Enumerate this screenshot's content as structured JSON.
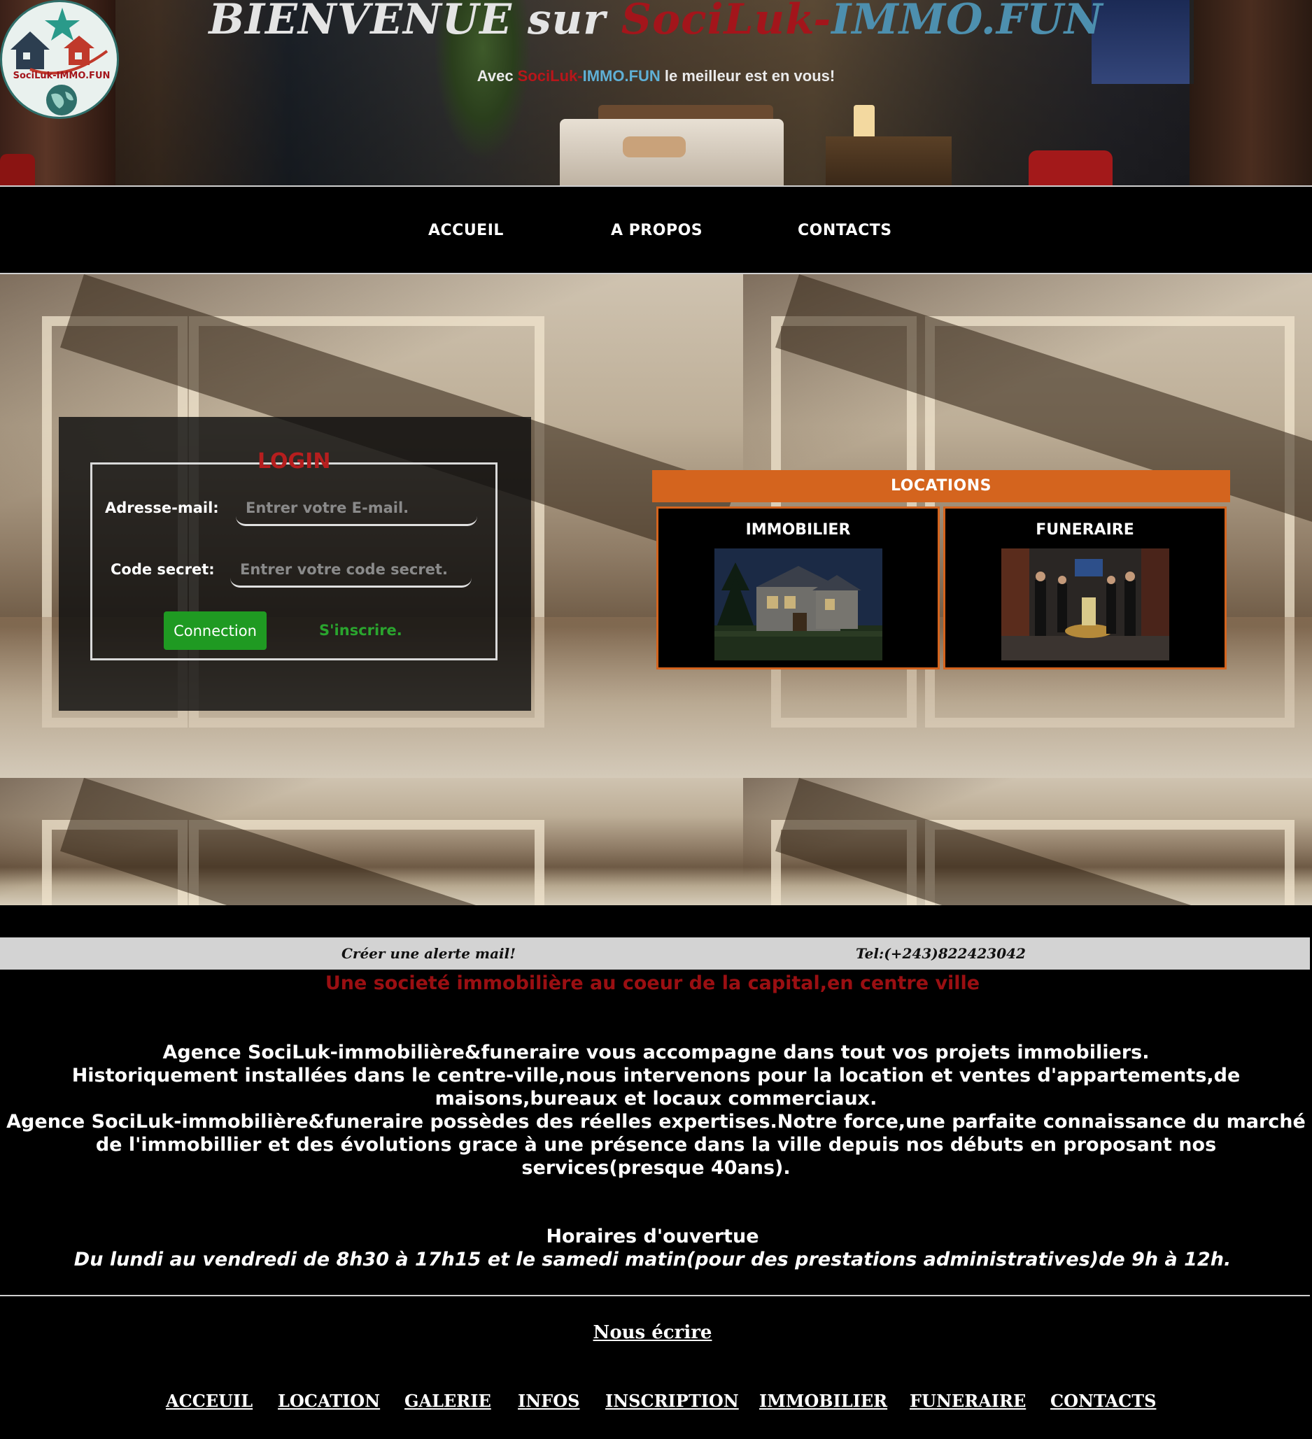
{
  "header": {
    "title_part1": "BIENVENUE sur ",
    "title_part2": "SociLuk-",
    "title_part3": "IMMO.FUN",
    "subtitle_part1": "Avec ",
    "subtitle_part2": "SociLuk-",
    "subtitle_part3": "IMMO.FUN",
    "subtitle_part4": " le meilleur est en vous!",
    "logo_text": "SociLuk-IMMO.FUN"
  },
  "nav": {
    "items": [
      {
        "label": "ACCUEIL"
      },
      {
        "label": "A PROPOS"
      },
      {
        "label": "CONTACTS"
      }
    ]
  },
  "login": {
    "legend": "LOGIN",
    "email_label": "Adresse-mail:",
    "email_placeholder": "Entrer votre E-mail.",
    "password_label": "Code secret:",
    "password_placeholder": "Entrer votre code secret.",
    "connect_label": "Connection",
    "signup_label": "S'inscrire."
  },
  "locations": {
    "header": "LOCATIONS",
    "cards": [
      {
        "title": "IMMOBILIER"
      },
      {
        "title": "FUNERAIRE"
      }
    ]
  },
  "infobar": {
    "alert_link": "Créer une alerte mail!",
    "phone": "Tel:(+243)822423042"
  },
  "tagline": "Une societé immobilière au coeur de la capital,en centre ville",
  "about": {
    "line1": "Agence SociLuk-immobilière&funeraire vous accompagne dans tout vos projets immobiliers.",
    "line2": "Historiquement installées dans le centre-ville,nous intervenons pour la location et ventes d'appartements,de maisons,bureaux et locaux commerciaux.",
    "line3": "Agence SociLuk-immobilière&funeraire possèdes des réelles expertises.Notre force,une parfaite connaissance du marché de l'immobillier et des évolutions grace à une présence dans la ville depuis nos débuts en proposant nos services(presque 40ans)."
  },
  "hours": {
    "title": "Horaires d'ouvertue",
    "text": "Du lundi au vendredi de 8h30 à 17h15 et le samedi matin(pour des prestations administratives)de 9h à 12h."
  },
  "contact": {
    "write_us": "Nous écrire"
  },
  "footer_nav": {
    "items": [
      {
        "label": "ACCEUIL"
      },
      {
        "label": "LOCATION"
      },
      {
        "label": "GALERIE"
      },
      {
        "label": "INFOS"
      },
      {
        "label": "INSCRIPTION"
      },
      {
        "label": "IMMOBILIER"
      },
      {
        "label": "FUNERAIRE"
      },
      {
        "label": "CONTACTS"
      }
    ]
  },
  "colors": {
    "brand_red": "#a3151b",
    "brand_blue": "#4d8fae",
    "locations_orange": "#d4641e",
    "connect_green": "#1f9a22"
  }
}
